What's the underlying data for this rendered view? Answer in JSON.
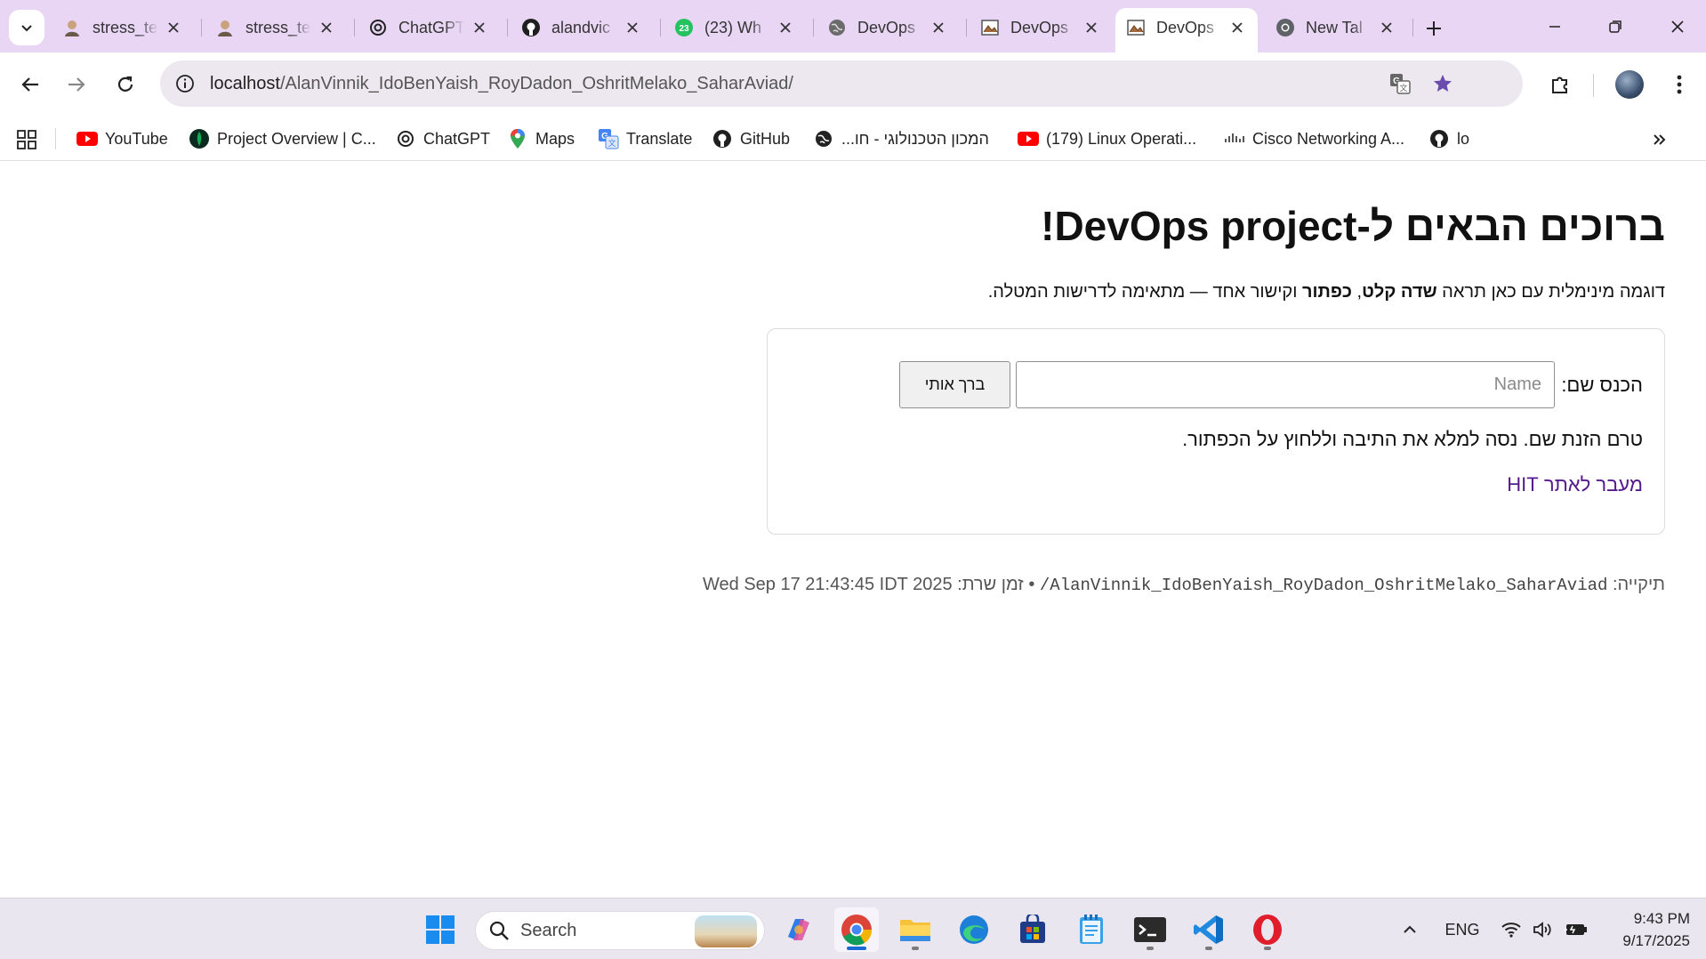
{
  "browser": {
    "tabs": [
      {
        "title": "stress_te",
        "icon": "avatar-icon",
        "active": false
      },
      {
        "title": "stress_te",
        "icon": "avatar-icon",
        "active": false
      },
      {
        "title": "ChatGPT",
        "icon": "chatgpt-icon",
        "active": false
      },
      {
        "title": "alandvic",
        "icon": "github-icon",
        "active": false
      },
      {
        "title": "(23) Wh",
        "icon": "whatsapp-icon",
        "badge": "23",
        "active": false
      },
      {
        "title": "DevOps",
        "icon": "globe-icon",
        "active": false
      },
      {
        "title": "DevOps",
        "icon": "page-icon",
        "active": false
      },
      {
        "title": "DevOps",
        "icon": "page-icon",
        "active": true
      },
      {
        "title": "New Tal",
        "icon": "chrome-icon",
        "active": false
      }
    ],
    "url_host": "localhost",
    "url_path": "/AlanVinnik_IdoBenYaish_RoyDadon_OshritMelako_SaharAviad/",
    "bookmarks": [
      {
        "label": "YouTube",
        "icon": "youtube-icon"
      },
      {
        "label": "Project Overview | C...",
        "icon": "mongodb-icon"
      },
      {
        "label": "ChatGPT",
        "icon": "chatgpt-icon"
      },
      {
        "label": "Maps",
        "icon": "maps-icon"
      },
      {
        "label": "Translate",
        "icon": "translate-icon"
      },
      {
        "label": "GitHub",
        "icon": "github-icon"
      },
      {
        "label": "המכון הטכנולוגי - חו...",
        "icon": "globe-icon"
      },
      {
        "label": "(179) Linux Operati...",
        "icon": "youtube-icon"
      },
      {
        "label": "Cisco Networking A...",
        "icon": "cisco-icon"
      },
      {
        "label": "lo",
        "icon": "github-icon"
      }
    ]
  },
  "page": {
    "title": "ברוכים הבאים ל-DevOps project!",
    "desc_part1": "דוגמה מינימלית עם כאן תראה ",
    "desc_bold1": "שדה קלט",
    "desc_part2": ", ",
    "desc_bold2": "כפתור",
    "desc_part3": " וקישור אחד — מתאימה לדרישות המטלה.",
    "name_label": "הכנס שם:",
    "name_placeholder": "Name",
    "greet_button": "ברך אותי",
    "status_message": "טרם הזנת שם. נסה למלא את התיבה וללחוץ על הכפתור.",
    "hit_link": "מעבר לאתר HIT",
    "footer_folder_label": "תיקייה: ",
    "footer_folder": "/AlanVinnik_IdoBenYaish_RoyDadon_OshritMelako_SaharAviad",
    "footer_sep": " • ",
    "footer_time_label": "זמן שרת: ",
    "footer_time": "Wed Sep 17 21:43:45 IDT 2025"
  },
  "taskbar": {
    "search_label": "Search",
    "lang": "ENG",
    "time": "9:43 PM",
    "date": "9/17/2025"
  },
  "colors": {
    "tabstrip": "#e9d6f5",
    "link": "#551a8b",
    "accent": "#1a6ad6"
  }
}
